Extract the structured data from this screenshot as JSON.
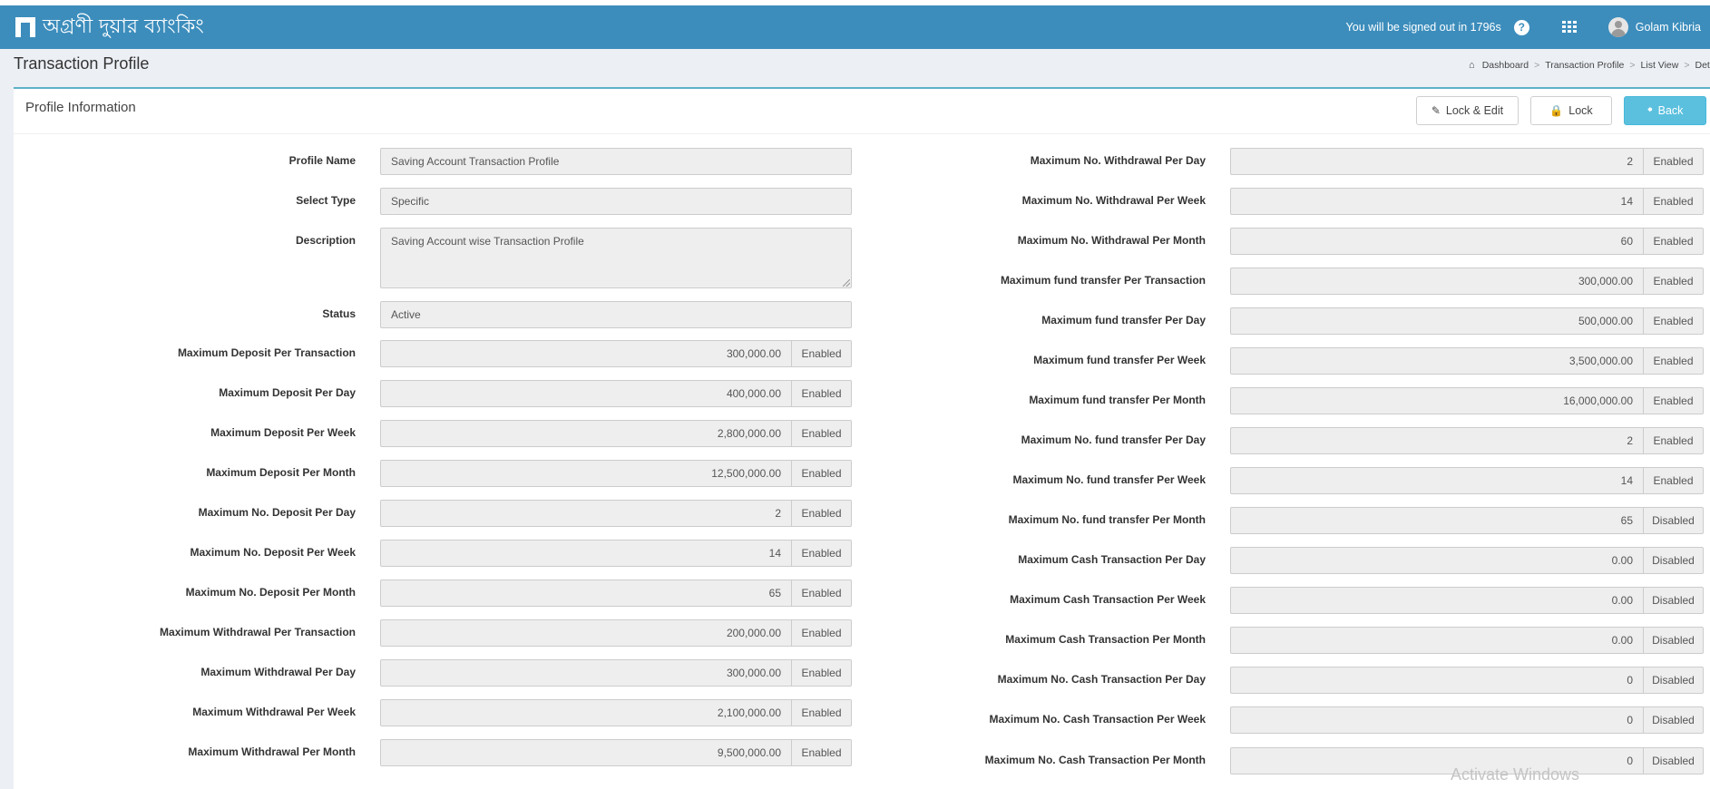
{
  "header": {
    "logo_text": "অগ্রণী দুয়ার ব্যাংকিং",
    "signout_text": "You will be signed out in 1796s",
    "help_glyph": "?",
    "user_name": "Golam Kibria"
  },
  "page": {
    "title": "Transaction Profile",
    "breadcrumb": [
      "Dashboard",
      "Transaction Profile",
      "List View",
      "Detai"
    ]
  },
  "box": {
    "title": "Profile Information",
    "buttons": {
      "lock_edit": "Lock & Edit",
      "lock": "Lock",
      "back": "Back"
    }
  },
  "left_fields": [
    {
      "label": "Profile Name",
      "value": "Saving Account Transaction Profile",
      "kind": "text"
    },
    {
      "label": "Select Type",
      "value": "Specific",
      "kind": "text"
    },
    {
      "label": "Description",
      "value": "Saving Account wise Transaction Profile",
      "kind": "textarea"
    },
    {
      "label": "Status",
      "value": "Active",
      "kind": "text"
    },
    {
      "label": "Maximum Deposit Per Transaction",
      "value": "300,000.00",
      "status": "Enabled",
      "kind": "num"
    },
    {
      "label": "Maximum Deposit Per Day",
      "value": "400,000.00",
      "status": "Enabled",
      "kind": "num"
    },
    {
      "label": "Maximum Deposit Per Week",
      "value": "2,800,000.00",
      "status": "Enabled",
      "kind": "num"
    },
    {
      "label": "Maximum Deposit Per Month",
      "value": "12,500,000.00",
      "status": "Enabled",
      "kind": "num"
    },
    {
      "label": "Maximum No. Deposit Per Day",
      "value": "2",
      "status": "Enabled",
      "kind": "num"
    },
    {
      "label": "Maximum No. Deposit Per Week",
      "value": "14",
      "status": "Enabled",
      "kind": "num"
    },
    {
      "label": "Maximum No. Deposit Per Month",
      "value": "65",
      "status": "Enabled",
      "kind": "num"
    },
    {
      "label": "Maximum Withdrawal Per Transaction",
      "value": "200,000.00",
      "status": "Enabled",
      "kind": "num"
    },
    {
      "label": "Maximum Withdrawal Per Day",
      "value": "300,000.00",
      "status": "Enabled",
      "kind": "num"
    },
    {
      "label": "Maximum Withdrawal Per Week",
      "value": "2,100,000.00",
      "status": "Enabled",
      "kind": "num"
    },
    {
      "label": "Maximum Withdrawal Per Month",
      "value": "9,500,000.00",
      "status": "Enabled",
      "kind": "num"
    }
  ],
  "right_fields": [
    {
      "label": "Maximum No. Withdrawal Per Day",
      "value": "2",
      "status": "Enabled"
    },
    {
      "label": "Maximum No. Withdrawal Per Week",
      "value": "14",
      "status": "Enabled"
    },
    {
      "label": "Maximum No. Withdrawal Per Month",
      "value": "60",
      "status": "Enabled"
    },
    {
      "label": "Maximum fund transfer Per Transaction",
      "value": "300,000.00",
      "status": "Enabled"
    },
    {
      "label": "Maximum fund transfer Per Day",
      "value": "500,000.00",
      "status": "Enabled"
    },
    {
      "label": "Maximum fund transfer Per Week",
      "value": "3,500,000.00",
      "status": "Enabled"
    },
    {
      "label": "Maximum fund transfer Per Month",
      "value": "16,000,000.00",
      "status": "Enabled"
    },
    {
      "label": "Maximum No. fund transfer Per Day",
      "value": "2",
      "status": "Enabled"
    },
    {
      "label": "Maximum No. fund transfer Per Week",
      "value": "14",
      "status": "Enabled"
    },
    {
      "label": "Maximum No. fund transfer Per Month",
      "value": "65",
      "status": "Disabled"
    },
    {
      "label": "Maximum Cash Transaction Per Day",
      "value": "0.00",
      "status": "Disabled"
    },
    {
      "label": "Maximum Cash Transaction Per Week",
      "value": "0.00",
      "status": "Disabled"
    },
    {
      "label": "Maximum Cash Transaction Per Month",
      "value": "0.00",
      "status": "Disabled"
    },
    {
      "label": "Maximum No. Cash Transaction Per Day",
      "value": "0",
      "status": "Disabled"
    },
    {
      "label": "Maximum No. Cash Transaction Per Week",
      "value": "0",
      "status": "Disabled"
    },
    {
      "label": "Maximum No. Cash Transaction Per Month",
      "value": "0",
      "status": "Disabled"
    }
  ],
  "watermark": "Activate Windows",
  "colors": {
    "topbar": "#3c8dbc",
    "back_button": "#5bc0de",
    "box_border": "#5fb0c9"
  }
}
